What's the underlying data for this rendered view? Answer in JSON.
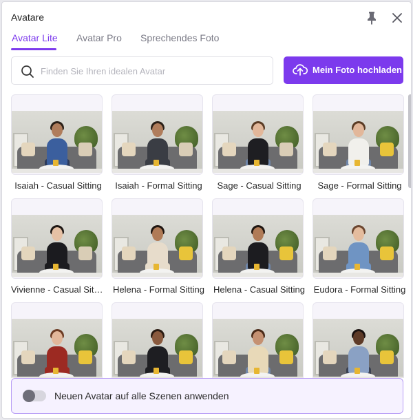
{
  "header": {
    "title": "Avatare"
  },
  "tabs": [
    {
      "label": "Avatar Lite",
      "active": true
    },
    {
      "label": "Avatar Pro",
      "active": false
    },
    {
      "label": "Sprechendes Foto",
      "active": false
    }
  ],
  "search": {
    "placeholder": "Finden Sie Ihren idealen Avatar",
    "value": ""
  },
  "upload_button": {
    "label": "Mein Foto hochladen"
  },
  "avatars": [
    {
      "label": "Isaiah - Casual Sitting",
      "skin": "#b07d5c",
      "hair": "#2b2018",
      "top": "#3b5f9e",
      "bottom": "#2c3a5a",
      "pillow": "#d9cdb6"
    },
    {
      "label": "Isaiah - Formal Sitting",
      "skin": "#b07d5c",
      "hair": "#2b2018",
      "top": "#3a3d44",
      "bottom": "#3a3d44",
      "pillow": "#d9cdb6"
    },
    {
      "label": "Sage - Casual Sitting",
      "skin": "#e2b79a",
      "hair": "#5a3b24",
      "top": "#1e1e22",
      "bottom": "#6f86a9",
      "pillow": "#d9cdb6"
    },
    {
      "label": "Sage - Formal Sitting",
      "skin": "#e2b79a",
      "hair": "#5a3b24",
      "top": "#f1f0ec",
      "bottom": "#6f86a9",
      "pillow": "#e8c43a"
    },
    {
      "label": "Vivienne - Casual Sitting",
      "skin": "#e6c1a5",
      "hair": "#1d1714",
      "top": "#1b1b1f",
      "bottom": "#1b1b1f",
      "pillow": "#d9cdb6"
    },
    {
      "label": "Helena - Formal Sitting",
      "skin": "#b07b57",
      "hair": "#1f1611",
      "top": "#e7dccb",
      "bottom": "#e7dccb",
      "pillow": "#e8c43a"
    },
    {
      "label": "Helena - Casual Sitting",
      "skin": "#b07b57",
      "hair": "#1f1611",
      "top": "#1c1c20",
      "bottom": "#6f86a9",
      "pillow": "#e8c43a"
    },
    {
      "label": "Eudora - Formal Sitting",
      "skin": "#e4bc9e",
      "hair": "#6b4630",
      "top": "#6f94c3",
      "bottom": "#6f94c3",
      "pillow": "#e8c43a"
    },
    {
      "label": "",
      "skin": "#e2b79a",
      "hair": "#6b3a22",
      "top": "#9c2a22",
      "bottom": "#9c2a22",
      "pillow": "#e8c43a"
    },
    {
      "label": "",
      "skin": "#8a5a3e",
      "hair": "#2a1b12",
      "top": "#1e1e22",
      "bottom": "#1e1e22",
      "pillow": "#e8c43a"
    },
    {
      "label": "",
      "skin": "#c59172",
      "hair": "#4a2a18",
      "top": "#e8d9b8",
      "bottom": "#6f86a9",
      "pillow": "#e8c43a"
    },
    {
      "label": "",
      "skin": "#5e3b28",
      "hair": "#1a1210",
      "top": "#8aa1c4",
      "bottom": "#3b4150",
      "pillow": "#e8c43a"
    }
  ],
  "footer": {
    "toggle_label": "Neuen Avatar auf alle Szenen anwenden",
    "toggle_on": false
  },
  "colors": {
    "accent": "#7c3aed",
    "accent_light": "#f6f2ff"
  },
  "icons": {
    "pin": "pin-icon",
    "close": "close-icon",
    "search": "search-icon",
    "upload": "cloud-upload-icon"
  }
}
